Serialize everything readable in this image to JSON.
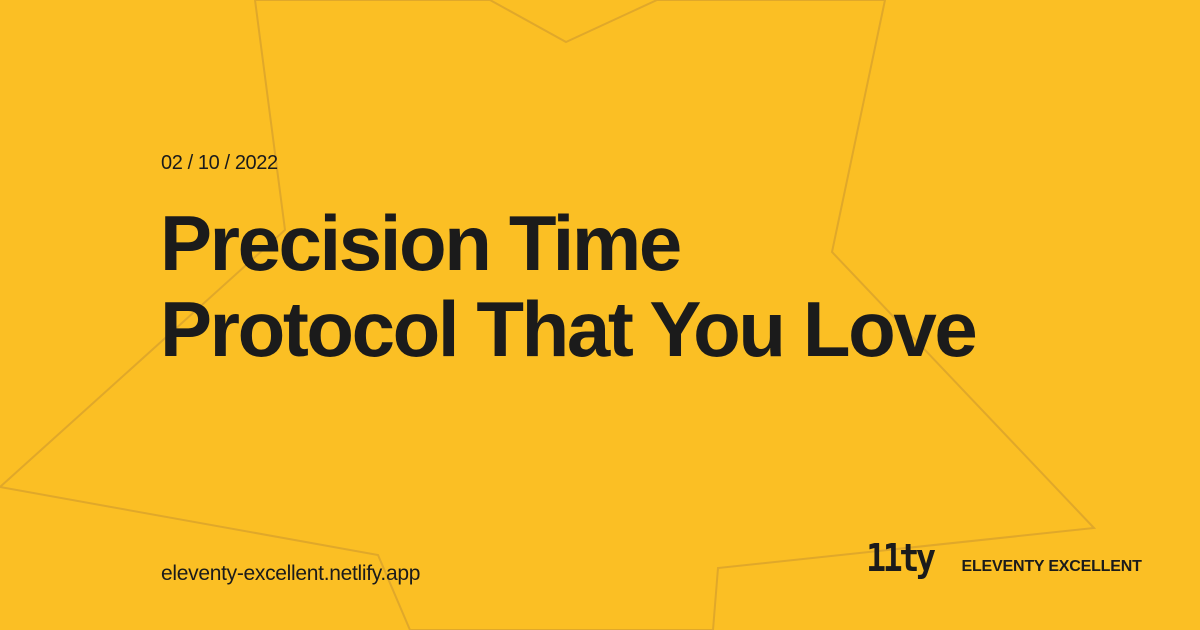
{
  "card": {
    "date": "02 / 10 / 2022",
    "title_lines": [
      "Precision Time",
      "Protocol That You Love"
    ],
    "site_url": "eleventy-excellent.netlify.app",
    "logo_text": "11ty",
    "brand_name": "ELEVENTY EXCELLENT"
  },
  "colors": {
    "background": "#fbbf24",
    "text": "#1b1b1b",
    "decoration_line": "#e0a82a"
  }
}
